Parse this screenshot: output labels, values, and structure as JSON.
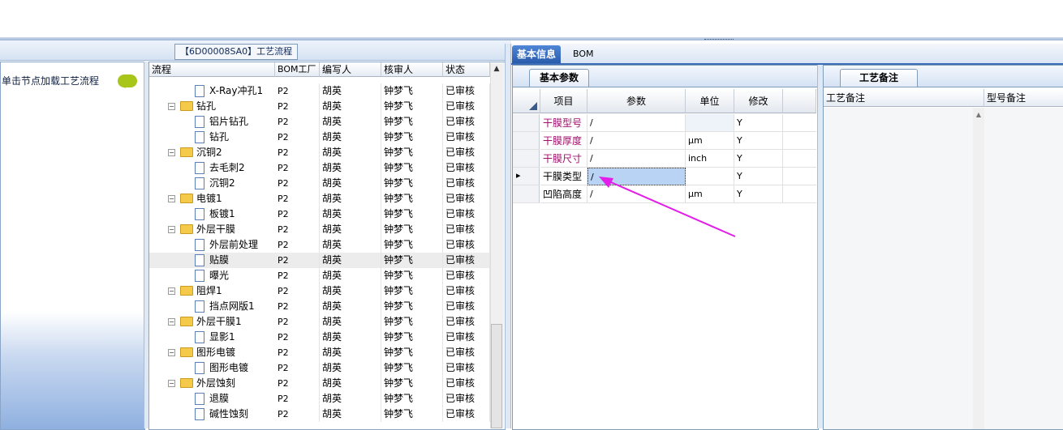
{
  "process_panel": {
    "title": "【6D00008SA0】工艺流程"
  },
  "left_panel": {
    "hint": "单击节点加载工艺流程"
  },
  "flow_grid": {
    "columns": [
      "流程",
      "BOM工厂",
      "编写人",
      "核审人",
      "状态"
    ],
    "rows": [
      {
        "name": "X-Ray冲孔1",
        "level": 2,
        "bom": "P2",
        "author": "胡英",
        "reviewer": "钟梦飞",
        "status": "已审核"
      },
      {
        "name": "钻孔",
        "level": 1,
        "bom": "P2",
        "author": "胡英",
        "reviewer": "钟梦飞",
        "status": "已审核"
      },
      {
        "name": "铝片钻孔",
        "level": 2,
        "bom": "P2",
        "author": "胡英",
        "reviewer": "钟梦飞",
        "status": "已审核"
      },
      {
        "name": "钻孔",
        "level": 2,
        "bom": "P2",
        "author": "胡英",
        "reviewer": "钟梦飞",
        "status": "已审核"
      },
      {
        "name": "沉铜2",
        "level": 1,
        "bom": "P2",
        "author": "胡英",
        "reviewer": "钟梦飞",
        "status": "已审核"
      },
      {
        "name": "去毛刺2",
        "level": 2,
        "bom": "P2",
        "author": "胡英",
        "reviewer": "钟梦飞",
        "status": "已审核"
      },
      {
        "name": "沉铜2",
        "level": 2,
        "bom": "P2",
        "author": "胡英",
        "reviewer": "钟梦飞",
        "status": "已审核"
      },
      {
        "name": "电镀1",
        "level": 1,
        "bom": "P2",
        "author": "胡英",
        "reviewer": "钟梦飞",
        "status": "已审核"
      },
      {
        "name": "板镀1",
        "level": 2,
        "bom": "P2",
        "author": "胡英",
        "reviewer": "钟梦飞",
        "status": "已审核"
      },
      {
        "name": "外层干膜",
        "level": 1,
        "bom": "P2",
        "author": "胡英",
        "reviewer": "钟梦飞",
        "status": "已审核"
      },
      {
        "name": "外层前处理",
        "level": 2,
        "bom": "P2",
        "author": "胡英",
        "reviewer": "钟梦飞",
        "status": "已审核"
      },
      {
        "name": "贴膜",
        "level": 2,
        "bom": "P2",
        "author": "胡英",
        "reviewer": "钟梦飞",
        "status": "已审核",
        "selected": true
      },
      {
        "name": "曝光",
        "level": 2,
        "bom": "P2",
        "author": "胡英",
        "reviewer": "钟梦飞",
        "status": "已审核"
      },
      {
        "name": "阻焊1",
        "level": 1,
        "bom": "P2",
        "author": "胡英",
        "reviewer": "钟梦飞",
        "status": "已审核"
      },
      {
        "name": "挡点网版1",
        "level": 2,
        "bom": "P2",
        "author": "胡英",
        "reviewer": "钟梦飞",
        "status": "已审核"
      },
      {
        "name": "外层干膜1",
        "level": 1,
        "bom": "P2",
        "author": "胡英",
        "reviewer": "钟梦飞",
        "status": "已审核"
      },
      {
        "name": "显影1",
        "level": 2,
        "bom": "P2",
        "author": "胡英",
        "reviewer": "钟梦飞",
        "status": "已审核"
      },
      {
        "name": "图形电镀",
        "level": 1,
        "bom": "P2",
        "author": "胡英",
        "reviewer": "钟梦飞",
        "status": "已审核"
      },
      {
        "name": "图形电镀",
        "level": 2,
        "bom": "P2",
        "author": "胡英",
        "reviewer": "钟梦飞",
        "status": "已审核"
      },
      {
        "name": "外层蚀刻",
        "level": 1,
        "bom": "P2",
        "author": "胡英",
        "reviewer": "钟梦飞",
        "status": "已审核"
      },
      {
        "name": "退膜",
        "level": 2,
        "bom": "P2",
        "author": "胡英",
        "reviewer": "钟梦飞",
        "status": "已审核"
      },
      {
        "name": "碱性蚀刻",
        "level": 2,
        "bom": "P2",
        "author": "胡英",
        "reviewer": "钟梦飞",
        "status": "已审核"
      }
    ]
  },
  "right_tabs": {
    "basic_info": "基本信息",
    "bom": "BOM"
  },
  "basic_params": {
    "tab": "基本参数",
    "columns": [
      "项目",
      "参数",
      "单位",
      "修改"
    ],
    "rows": [
      {
        "item": "干膜型号",
        "param": "/",
        "unit": "",
        "edit": "Y",
        "highlight": true
      },
      {
        "item": "干膜厚度",
        "param": "/",
        "unit": "μm",
        "edit": "Y",
        "highlight": true
      },
      {
        "item": "干膜尺寸",
        "param": "/",
        "unit": "inch",
        "edit": "Y",
        "highlight": true
      },
      {
        "item": "干膜类型",
        "param": "/",
        "unit": "",
        "edit": "Y",
        "highlight": false,
        "current": true
      },
      {
        "item": "凹陷高度",
        "param": "/",
        "unit": "μm",
        "edit": "Y",
        "highlight": false
      }
    ],
    "current_marker": "▸"
  },
  "process_notes": {
    "tab": "工艺备注",
    "columns": [
      "工艺备注",
      "型号备注"
    ]
  },
  "colors": {
    "highlight_text": "#a0106c",
    "arrow": "#e21ee8",
    "selected_cell": "#b8d3f4"
  }
}
